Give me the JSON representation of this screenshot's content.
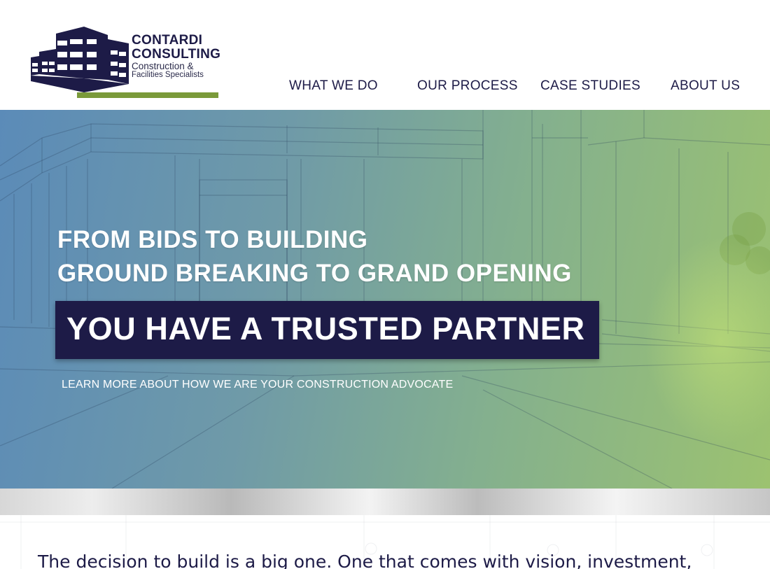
{
  "brand": {
    "name_line1": "CONTARDI",
    "name_line2": "CONSULTING",
    "tagline_line1": "Construction &",
    "tagline_line2": "Facilities Specialists",
    "primary_color": "#1d1b47",
    "accent_color": "#7a9a3a"
  },
  "nav": {
    "items": [
      {
        "label": "WHAT WE DO"
      },
      {
        "label": "OUR PROCESS"
      },
      {
        "label": "CASE STUDIES"
      },
      {
        "label": "ABOUT US"
      }
    ]
  },
  "hero": {
    "line1": "FROM BIDS TO BUILDING",
    "line2": "GROUND BREAKING TO GRAND OPENING",
    "headline": "YOU HAVE A TRUSTED PARTNER",
    "link": "LEARN MORE ABOUT HOW WE ARE YOUR CONSTRUCTION ADVOCATE"
  },
  "intro": {
    "text": "The decision to build is a big one. One that comes with vision, investment,"
  }
}
